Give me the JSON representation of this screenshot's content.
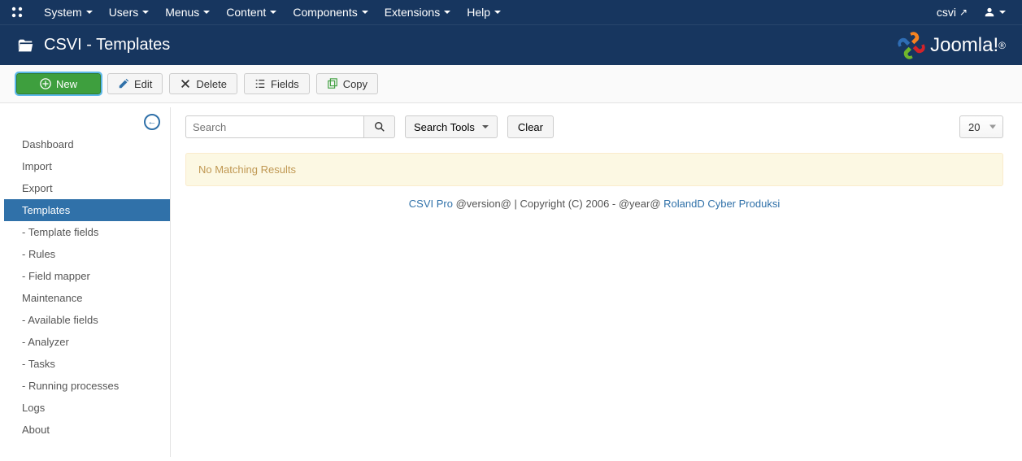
{
  "topmenu": {
    "items": [
      "System",
      "Users",
      "Menus",
      "Content",
      "Components",
      "Extensions",
      "Help"
    ],
    "site_name": "csvi"
  },
  "subheader": {
    "title": "CSVI - Templates"
  },
  "toolbar": {
    "new": "New",
    "edit": "Edit",
    "delete": "Delete",
    "fields": "Fields",
    "copy": "Copy"
  },
  "sidebar": {
    "items": [
      {
        "label": "Dashboard",
        "active": false
      },
      {
        "label": "Import",
        "active": false
      },
      {
        "label": "Export",
        "active": false
      },
      {
        "label": "Templates",
        "active": true
      },
      {
        "label": "- Template fields",
        "active": false
      },
      {
        "label": "- Rules",
        "active": false
      },
      {
        "label": "- Field mapper",
        "active": false
      },
      {
        "label": "Maintenance",
        "active": false
      },
      {
        "label": "- Available fields",
        "active": false
      },
      {
        "label": "- Analyzer",
        "active": false
      },
      {
        "label": "- Tasks",
        "active": false
      },
      {
        "label": "- Running processes",
        "active": false
      },
      {
        "label": "Logs",
        "active": false
      },
      {
        "label": "About",
        "active": false
      }
    ]
  },
  "filter": {
    "search_placeholder": "Search",
    "search_tools": "Search Tools",
    "clear": "Clear",
    "limit": "20"
  },
  "alert": {
    "message": "No Matching Results"
  },
  "footer": {
    "product": "CSVI Pro",
    "middle": " @version@ | Copyright (C) 2006 - @year@ ",
    "company": "RolandD Cyber Produksi"
  },
  "brand": {
    "name": "Joomla!"
  }
}
